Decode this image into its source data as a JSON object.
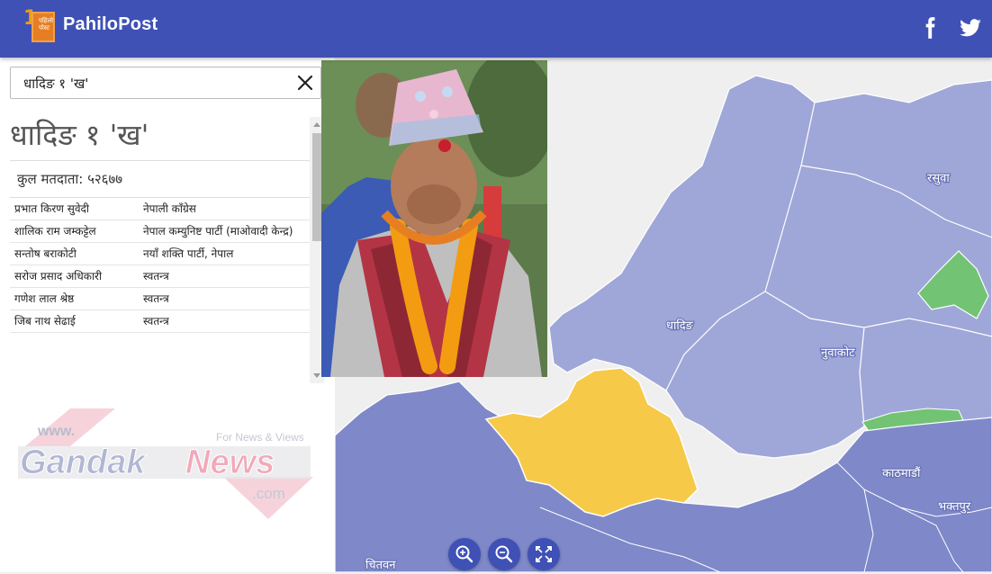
{
  "header": {
    "brand": "PahiloPost",
    "logo_text": "पहिलो पोस्ट",
    "brand_color": "#3f51b5",
    "icons": [
      "facebook-icon",
      "twitter-icon"
    ]
  },
  "search": {
    "value": "धादिङ १ 'ख'",
    "clear_icon": "close-icon"
  },
  "constituency": {
    "title": "धादिङ १ 'ख'",
    "voters": "कुल मतदाता: ५२६७७",
    "candidates": [
      {
        "name": "प्रभात किरण सुवेदी",
        "party": "नेपाली काँग्रेस"
      },
      {
        "name": "शालिक राम जम्कट्टेल",
        "party": "नेपाल कम्युनिष्ट पार्टी (माओवादी केन्द्र)"
      },
      {
        "name": "सन्तोष बराकोटी",
        "party": "नयाँ शक्ति पार्टी, नेपाल"
      },
      {
        "name": "सरोज प्रसाद अधिकारी",
        "party": "स्वतन्त्र"
      },
      {
        "name": "गणेश लाल श्रेष्ठ",
        "party": "स्वतन्त्र"
      },
      {
        "name": "जिब नाथ सेढाई",
        "party": "स्वतन्त्र"
      }
    ]
  },
  "watermark": {
    "www": "www.",
    "name1": "Gandak",
    "name2": "News",
    "tld": ".com",
    "tagline": "For News & Views"
  },
  "map": {
    "labels": {
      "rasuwa": "रसुवा",
      "dhading": "धादिङ",
      "nuwakot": "नुवाकोट",
      "kathmandu": "काठमाडौं",
      "bhaktapur": "भक्तपुर",
      "chitwan": "चितवन"
    },
    "colors": {
      "light": "#9fa7d8",
      "dark": "#7f88c9",
      "selected": "#f7c948",
      "green": "#72c374"
    }
  },
  "controls": {
    "icons": [
      "zoom-in-icon",
      "zoom-out-icon",
      "fullscreen-icon"
    ]
  }
}
